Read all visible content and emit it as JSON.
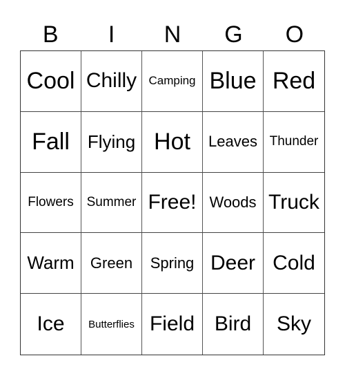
{
  "header": [
    "B",
    "I",
    "N",
    "G",
    "O"
  ],
  "cells": [
    "Cool",
    "Chilly",
    "Camping",
    "Blue",
    "Red",
    "Fall",
    "Flying",
    "Hot",
    "Leaves",
    "Thunder",
    "Flowers",
    "Summer",
    "Free!",
    "Woods",
    "Truck",
    "Warm",
    "Green",
    "Spring",
    "Deer",
    "Cold",
    "Ice",
    "Butterflies",
    "Field",
    "Bird",
    "Sky"
  ]
}
